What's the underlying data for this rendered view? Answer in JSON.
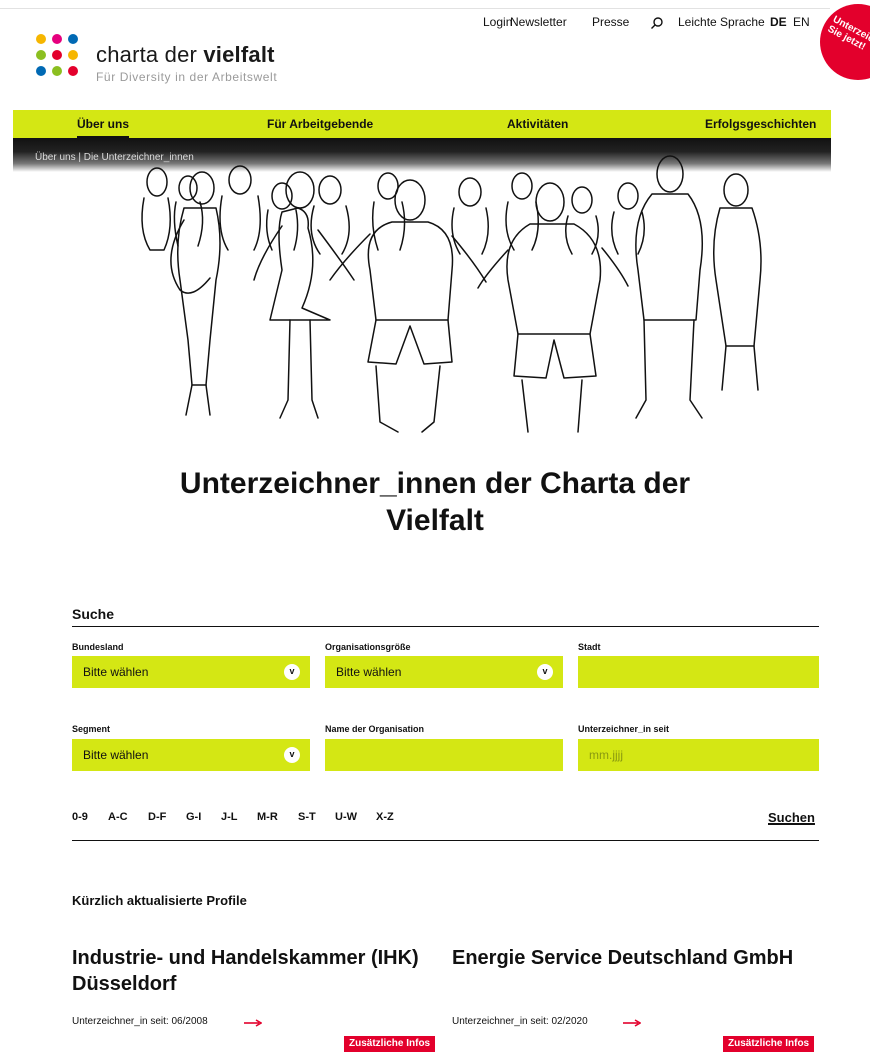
{
  "logo": {
    "title_regular": "charta der ",
    "title_bold": "vielfalt",
    "subtitle": "Für Diversity in der Arbeitswelt",
    "dot_colors": [
      "#f6b600",
      "#e6007e",
      "#0069b4",
      "#8bbf20",
      "#e3002c",
      "#f6b600",
      "#0069b4",
      "#8bbf20",
      "#e3002c"
    ]
  },
  "toplinks": {
    "login": "Login",
    "newsletter": "Newsletter",
    "presse": "Presse",
    "leichte_sprache": "Leichte Sprache",
    "lang_de": "DE",
    "lang_en": "EN"
  },
  "badge": {
    "text": "Unterzeichnen Sie jetzt!"
  },
  "nav": {
    "items": [
      "Über uns",
      "Für Arbeitgebende",
      "Aktivitäten",
      "Erfolgsgeschichten"
    ],
    "active": "Über uns"
  },
  "breadcrumb": "Über uns  |  Die Unterzeichner_innen",
  "page_title": "Unterzeichner_innen der Charta der Vielfalt",
  "search": {
    "title": "Suche",
    "fields": [
      {
        "label": "Bundesland",
        "value": "Bitte wählen"
      },
      {
        "label": "Organisationsgröße",
        "value": "Bitte wählen"
      },
      {
        "label": "Stadt",
        "value": ""
      },
      {
        "label": "Segment",
        "value": "Bitte wählen"
      },
      {
        "label": "Name der Organisation",
        "value": ""
      },
      {
        "label": "Unterzeichner_in seit",
        "placeholder": "mm.jjjj"
      }
    ],
    "alpha_filters": [
      "0-9",
      "A-C",
      "D-F",
      "G-I",
      "J-L",
      "M-R",
      "S-T",
      "U-W",
      "X-Z"
    ],
    "submit": "Suchen"
  },
  "recent": {
    "heading": "Kürzlich aktualisierte Profile",
    "cards": [
      {
        "title": "Industrie- und Handelskammer (IHK) Düsseldorf",
        "since": "Unterzeichner_in seit: 06/2008",
        "button": "Zusätzliche Infos"
      },
      {
        "title": "Energie Service Deutschland GmbH",
        "since": "Unterzeichner_in seit: 02/2020",
        "button": "Zusätzliche Infos"
      }
    ]
  },
  "colors": {
    "accent_green": "#d4e714",
    "accent_red": "#e3002c"
  },
  "icons": {
    "search": "search-icon",
    "chevron": "chevron-down-icon",
    "arrow": "arrow-right-icon"
  }
}
